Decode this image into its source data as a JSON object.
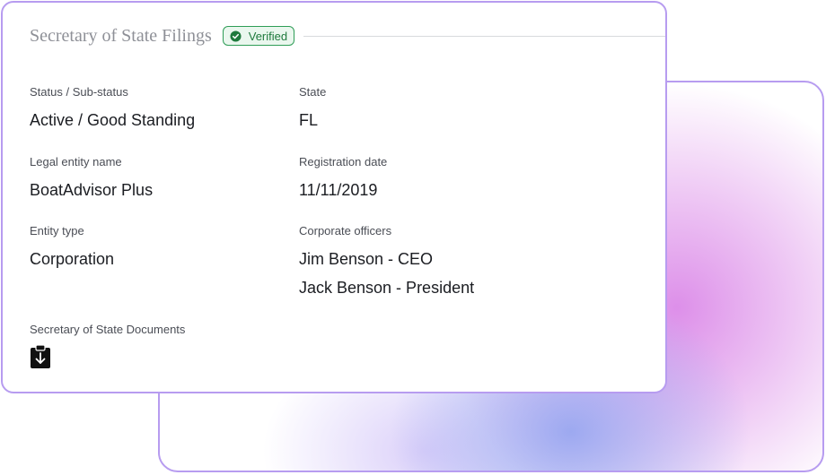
{
  "card": {
    "title": "Secretary of State Filings",
    "badge": {
      "label": "Verified",
      "icon": "check-circle-icon",
      "color": "#2f9d57"
    }
  },
  "fields": {
    "status": {
      "label": "Status / Sub-status",
      "value": "Active / Good Standing"
    },
    "state": {
      "label": "State",
      "value": "FL"
    },
    "legal_name": {
      "label": "Legal entity name",
      "value": "BoatAdvisor Plus"
    },
    "registration_date": {
      "label": "Registration date",
      "value": "11/11/2019"
    },
    "entity_type": {
      "label": "Entity type",
      "value": "Corporation"
    },
    "officers": {
      "label": "Corporate officers",
      "values": [
        "Jim Benson - CEO",
        "Jack Benson - President"
      ]
    }
  },
  "documents": {
    "label": "Secretary of State Documents",
    "icon": "clipboard-download-icon"
  },
  "colors": {
    "accent_border": "#b79cf0",
    "glow_pink": "#db89e8",
    "glow_blue": "#98a6f0"
  }
}
